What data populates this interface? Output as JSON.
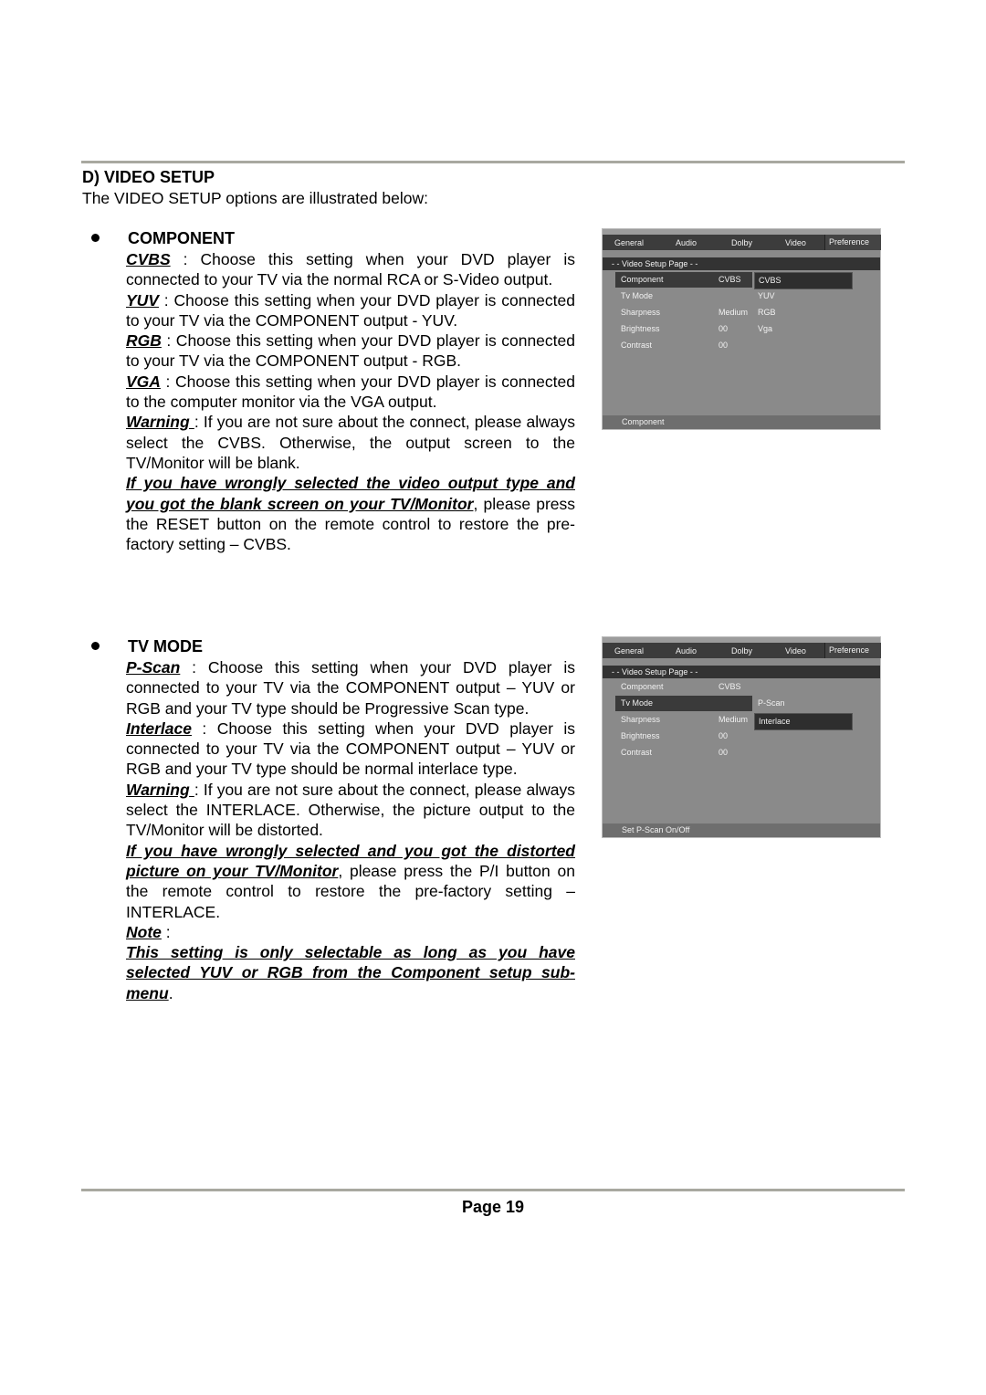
{
  "section": {
    "title": "D) VIDEO SETUP",
    "intro": "The VIDEO SETUP options are illustrated below:"
  },
  "component": {
    "heading": "COMPONENT",
    "items": [
      {
        "term": "CVBS",
        "text": " : Choose this setting when your DVD player is connected to your TV via the normal RCA or S-Video output."
      },
      {
        "term": "YUV",
        "text": " : Choose this setting when your DVD player is connected to your TV via the COMPONENT output - YUV."
      },
      {
        "term": "RGB",
        "text": " : Choose this setting when your DVD player is connected to your TV via the COMPONENT output - RGB."
      },
      {
        "term": "VGA",
        "text": " : Choose this setting when your DVD player is connected to the computer monitor via the VGA output."
      },
      {
        "term": "Warning ",
        "text": ": If you are not sure about the connect, please always select the CVBS. Otherwise, the output screen to the TV/Monitor will be blank."
      }
    ],
    "remedy_emph": "If you have wrongly selected the video output type and you got the blank screen on your TV/Monitor",
    "remedy_text": ", please press the RESET button on the remote control to restore the pre-factory setting – CVBS."
  },
  "tv_mode": {
    "heading": "TV MODE",
    "items": [
      {
        "term": "P-Scan",
        "text": " : Choose this setting when your DVD player is connected to your TV via the COMPONENT output – YUV or RGB and your TV type should be Progressive Scan type."
      },
      {
        "term": "Interlace",
        "text": " : Choose this setting when your DVD player is connected to your TV via the COMPONENT output – YUV or RGB and your TV type should be normal interlace type."
      },
      {
        "term": "Warning ",
        "text": ": If you are not sure about the connect, please always select the INTERLACE. Otherwise, the picture output to the TV/Monitor will be distorted."
      }
    ],
    "remedy_emph": "If you have wrongly selected and you got the distorted picture on your TV/Monitor",
    "remedy_text": ", please press the P/I button on the remote control to restore the pre-factory setting – INTERLACE.",
    "note_label": "Note",
    "note_colon": " :",
    "note_emph": "This setting is only selectable as long as you have selected YUV or RGB from the Component setup sub-menu",
    "note_end": "."
  },
  "osd": {
    "tabs": [
      "General",
      "Audio",
      "Dolby",
      "Video",
      "Preference"
    ],
    "page_title": "- -  Video  Setup  Page  - -",
    "rows": [
      {
        "label": "Component",
        "value": "CVBS"
      },
      {
        "label": "Tv Mode",
        "value": ""
      },
      {
        "label": "Sharpness",
        "value": "Medium"
      },
      {
        "label": "Brightness",
        "value": "00"
      },
      {
        "label": "Contrast",
        "value": "00"
      }
    ],
    "screen1": {
      "options": [
        "CVBS",
        "YUV",
        "RGB",
        "Vga"
      ],
      "selected_option": "CVBS",
      "footer": "Component"
    },
    "screen2": {
      "options": [
        "P-Scan",
        "Interlace"
      ],
      "selected_option": "Interlace",
      "footer": "Set  P-Scan  On/Off"
    }
  },
  "footer": {
    "page": "Page 19"
  }
}
